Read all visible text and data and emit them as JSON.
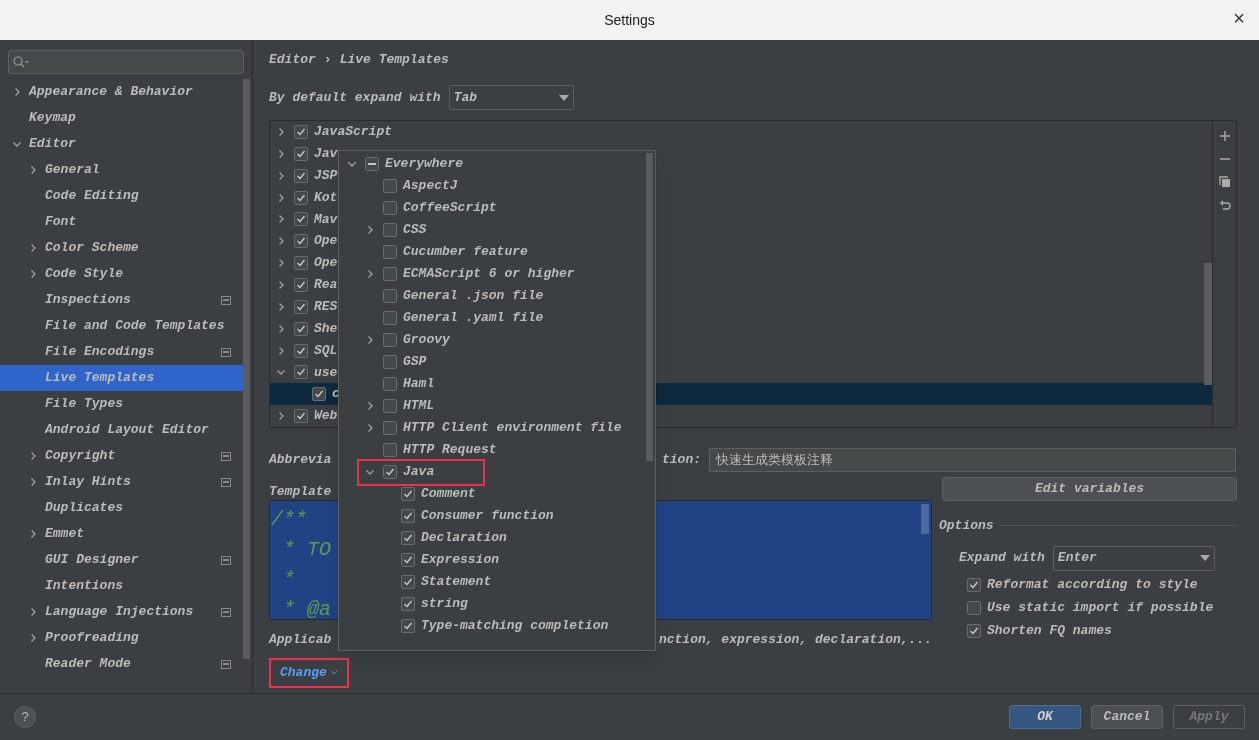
{
  "window": {
    "title": "Settings",
    "close": "×"
  },
  "sidebar": {
    "items": [
      {
        "label": "Appearance & Behavior",
        "expanded": false,
        "selected": false
      },
      {
        "label": "Keymap",
        "selected": false
      },
      {
        "label": "Editor",
        "expanded": true,
        "selected": false,
        "children": [
          {
            "label": "General",
            "expanded": false,
            "selected": false
          },
          {
            "label": "Code Editing",
            "selected": false
          },
          {
            "label": "Font",
            "selected": false
          },
          {
            "label": "Color Scheme",
            "expanded": false,
            "selected": false
          },
          {
            "label": "Code Style",
            "expanded": false,
            "selected": false
          },
          {
            "label": "Inspections",
            "selected": false,
            "project_level": true
          },
          {
            "label": "File and Code Templates",
            "selected": false
          },
          {
            "label": "File Encodings",
            "selected": false,
            "project_level": true
          },
          {
            "label": "Live Templates",
            "selected": true
          },
          {
            "label": "File Types",
            "selected": false
          },
          {
            "label": "Android Layout Editor",
            "selected": false
          },
          {
            "label": "Copyright",
            "expanded": false,
            "selected": false,
            "project_level": true
          },
          {
            "label": "Inlay Hints",
            "expanded": false,
            "selected": false,
            "project_level": true
          },
          {
            "label": "Duplicates",
            "selected": false
          },
          {
            "label": "Emmet",
            "expanded": false,
            "selected": false
          },
          {
            "label": "GUI Designer",
            "selected": false,
            "project_level": true
          },
          {
            "label": "Intentions",
            "selected": false
          },
          {
            "label": "Language Injections",
            "expanded": false,
            "selected": false,
            "project_level": true
          },
          {
            "label": "Proofreading",
            "expanded": false,
            "selected": false
          },
          {
            "label": "Reader Mode",
            "selected": false,
            "project_level": true
          }
        ]
      }
    ]
  },
  "breadcrumb": {
    "items": [
      "Editor",
      "Live Templates"
    ],
    "separator": "›"
  },
  "expand_default": {
    "label": "By default expand with",
    "value": "Tab"
  },
  "template_groups": [
    {
      "label": "JavaScript",
      "checked": true,
      "expanded": false,
      "selected": false
    },
    {
      "label": "Jav",
      "checked": true,
      "expanded": false,
      "selected": false
    },
    {
      "label": "JSP",
      "checked": true,
      "expanded": false,
      "selected": false
    },
    {
      "label": "Kot",
      "checked": true,
      "expanded": false,
      "selected": false
    },
    {
      "label": "Mav",
      "checked": true,
      "expanded": false,
      "selected": false
    },
    {
      "label": "Ope",
      "checked": true,
      "expanded": false,
      "selected": false
    },
    {
      "label": "Ope",
      "checked": true,
      "expanded": false,
      "selected": false
    },
    {
      "label": "Rea",
      "checked": true,
      "expanded": false,
      "selected": false
    },
    {
      "label": "RES",
      "checked": true,
      "expanded": false,
      "selected": false
    },
    {
      "label": "She",
      "checked": true,
      "expanded": false,
      "selected": false
    },
    {
      "label": "SQL",
      "checked": true,
      "expanded": false,
      "selected": false
    },
    {
      "label": "use",
      "checked": true,
      "expanded": true,
      "selected": false,
      "children": [
        {
          "label": "c",
          "checked": true,
          "selected": true
        }
      ]
    },
    {
      "label": "Web",
      "checked": true,
      "expanded": false,
      "selected": false
    }
  ],
  "abbreviation": {
    "label": "Abbrevia"
  },
  "description": {
    "label": "tion:",
    "value": "快速生成类模板注释"
  },
  "template_text": {
    "label": "Template",
    "lines": [
      "/**",
      " * TO",
      " *",
      " * @a"
    ]
  },
  "edit_variables": "Edit variables",
  "options": {
    "title": "Options",
    "expand_with": {
      "label": "Expand with",
      "value": "Enter"
    },
    "checkboxes": [
      {
        "label": "Reformat according to style",
        "checked": true
      },
      {
        "label": "Use static import if possible",
        "checked": false
      },
      {
        "label": "Shorten FQ names",
        "checked": true
      }
    ]
  },
  "applicable": {
    "label": "Applicab",
    "contexts": "nction, expression, declaration,..."
  },
  "change_link": {
    "label": "Change",
    "highlighted": true
  },
  "context_popup": {
    "items": [
      {
        "label": "Everywhere",
        "indeterminate": true,
        "expanded": true,
        "children": [
          {
            "label": "AspectJ",
            "checked": false
          },
          {
            "label": "CoffeeScript",
            "checked": false
          },
          {
            "label": "CSS",
            "checked": false,
            "expanded": false
          },
          {
            "label": "Cucumber feature",
            "checked": false
          },
          {
            "label": "ECMAScript 6 or higher",
            "checked": false,
            "expanded": false
          },
          {
            "label": "General .json file",
            "checked": false
          },
          {
            "label": "General .yaml file",
            "checked": false
          },
          {
            "label": "Groovy",
            "checked": false,
            "expanded": false
          },
          {
            "label": "GSP",
            "checked": false
          },
          {
            "label": "Haml",
            "checked": false
          },
          {
            "label": "HTML",
            "checked": false,
            "expanded": false
          },
          {
            "label": "HTTP Client environment file",
            "checked": false,
            "expanded": false
          },
          {
            "label": "HTTP Request",
            "checked": false
          },
          {
            "label": "Java",
            "checked": true,
            "expanded": true,
            "highlighted": true,
            "children": [
              {
                "label": "Comment",
                "checked": true
              },
              {
                "label": "Consumer function",
                "checked": true
              },
              {
                "label": "Declaration",
                "checked": true
              },
              {
                "label": "Expression",
                "checked": true
              },
              {
                "label": "Statement",
                "checked": true
              },
              {
                "label": "string",
                "checked": true
              },
              {
                "label": "Type-matching completion",
                "checked": true
              }
            ]
          }
        ]
      }
    ]
  },
  "footer": {
    "help": "?",
    "buttons": [
      {
        "label": "OK",
        "kind": "primary"
      },
      {
        "label": "Cancel",
        "kind": "normal"
      },
      {
        "label": "Apply",
        "kind": "disabled"
      }
    ]
  }
}
